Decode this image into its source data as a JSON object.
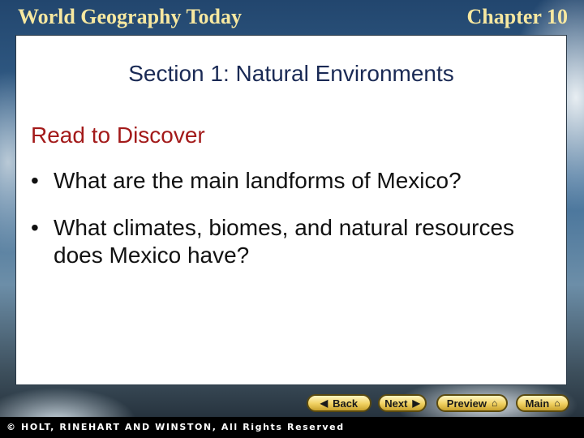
{
  "header": {
    "title": "World Geography Today",
    "chapter": "Chapter 10"
  },
  "slide": {
    "section_title": "Section 1: Natural Environments",
    "heading": "Read to Discover",
    "bullets": [
      "What are the main landforms of Mexico?",
      "What climates, biomes, and natural resources does Mexico have?"
    ],
    "bullet_marker": "•"
  },
  "nav": {
    "back_label": "Back",
    "next_label": "Next",
    "preview_label": "Preview",
    "main_label": "Main",
    "back_icon": "chevron-left-icon",
    "next_icon": "chevron-right-icon",
    "preview_icon": "home-icon",
    "main_icon": "home-icon"
  },
  "footer": {
    "copyright": "© HOLT, RINEHART AND WINSTON, All Rights Reserved"
  },
  "colors": {
    "header_text": "#f7e8a0",
    "section_title": "#1a2a55",
    "heading": "#a31a1a",
    "button_fill": "#f0d060"
  }
}
